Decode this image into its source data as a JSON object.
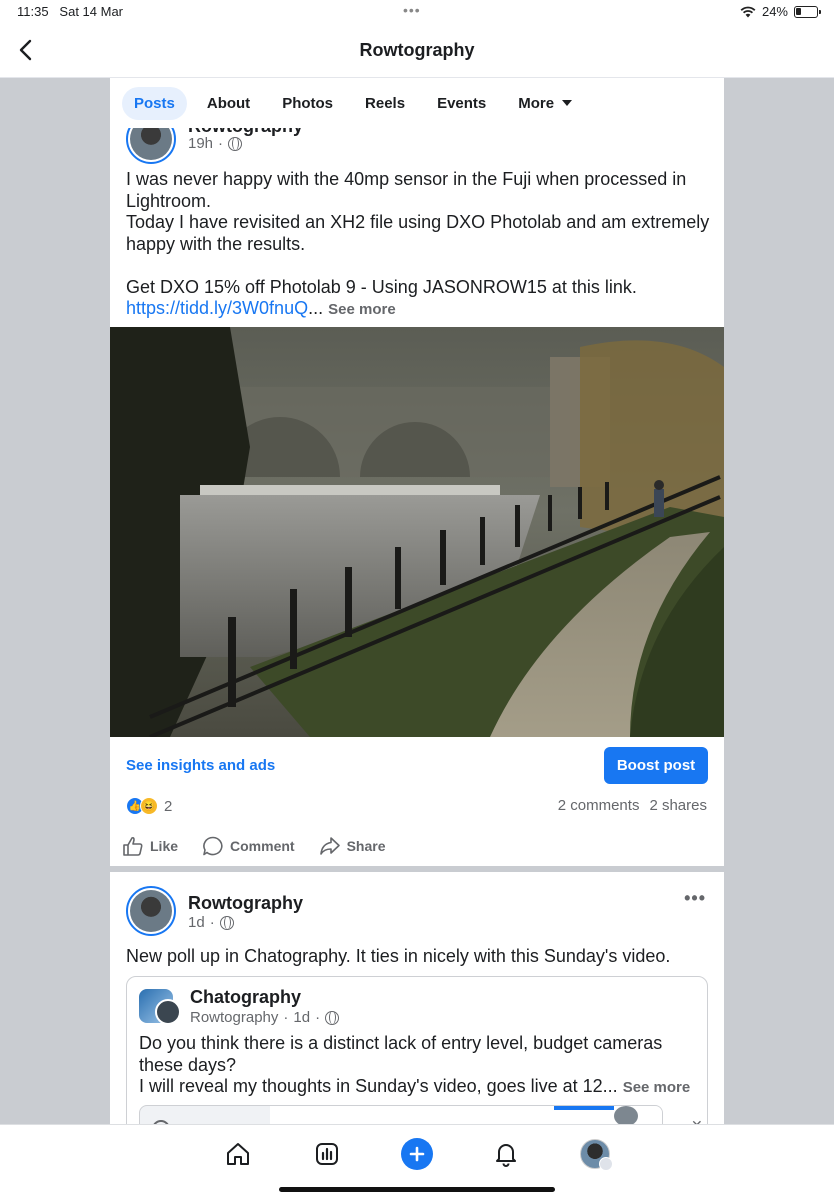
{
  "status_bar": {
    "time": "11:35",
    "date": "Sat 14 Mar",
    "battery": "24%",
    "icons": [
      "wifi-icon",
      "battery-icon"
    ]
  },
  "header": {
    "title": "Rowtography",
    "back_icon": "chevron-left-icon"
  },
  "tabs": [
    {
      "label": "Posts",
      "active": true
    },
    {
      "label": "About"
    },
    {
      "label": "Photos"
    },
    {
      "label": "Reels"
    },
    {
      "label": "Events"
    },
    {
      "label": "More"
    }
  ],
  "post1": {
    "author": "Rowtography",
    "time": "19h",
    "lines": [
      "I was never happy with the 40mp sensor in the Fuji when processed in Lightroom.",
      "Today I have revisited an XH2 file using DXO Photolab and am extremely happy with the results."
    ],
    "promo": "Get DXO 15% off Photolab 9 - Using JASONROW15 at this link.",
    "link": "https://tidd.ly/3W0fnuQ",
    "ellipsis": "...",
    "see_more": "See more",
    "insights": "See insights and ads",
    "boost": "Boost post",
    "reaction_count": "2",
    "comments": "2 comments",
    "shares": "2 shares",
    "actions": {
      "like": "Like",
      "comment": "Comment",
      "share": "Share"
    }
  },
  "post2": {
    "author": "Rowtography",
    "time": "1d",
    "text": "New poll up in Chatography. It ties in nicely with this Sunday's video.",
    "shared": {
      "group": "Chatography",
      "author": "Rowtography",
      "time": "1d",
      "line1": "Do you think there is a distinct lack of entry level, budget cameras these days?",
      "line2": "I will reveal my thoughts in Sunday's video, goes live at 12...",
      "see_more": "See more"
    }
  },
  "bottom_nav": [
    "home-icon",
    "insights-icon",
    "create-icon",
    "notifications-icon",
    "profile-icon"
  ],
  "colors": {
    "accent": "#1877f2",
    "gutter": "#c9ccd1",
    "text": "#1c1e21",
    "muted": "#65676b"
  }
}
